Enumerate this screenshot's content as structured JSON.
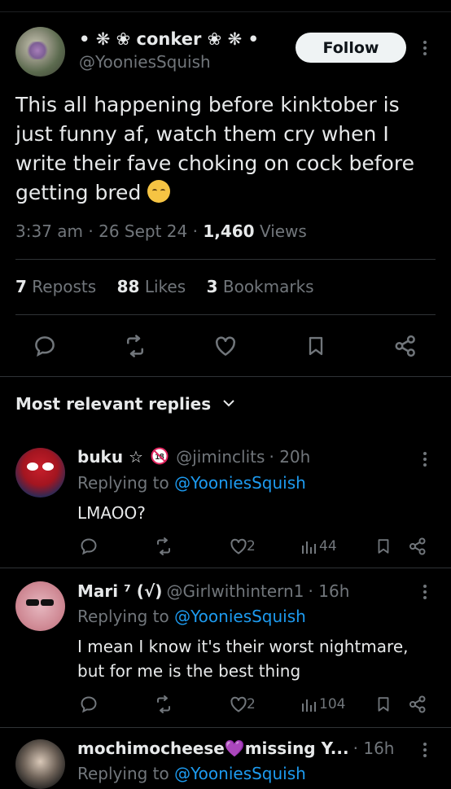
{
  "tweet": {
    "display_name": "• ❋ ❀ conker ❀ ❋ •",
    "handle": "@YooniesSquish",
    "follow_label": "Follow",
    "text": "This all happening before kinktober is just funny af, watch them cry when I write their fave choking on cock before getting bred",
    "time": "3:37 am",
    "date": "26 Sept 24",
    "views_count": "1,460",
    "views_label": "Views",
    "reposts_count": "7",
    "reposts_label": "Reposts",
    "likes_count": "88",
    "likes_label": "Likes",
    "bookmarks_count": "3",
    "bookmarks_label": "Bookmarks"
  },
  "replies_header": "Most relevant replies",
  "replies": [
    {
      "name": "buku ☆",
      "handle": "@jiminclits",
      "age": "20h",
      "replying_prefix": "Replying to",
      "replying_to": "@YooniesSquish",
      "text": "LMAOO?",
      "likes": "2",
      "views": "44"
    },
    {
      "name": "Mari ⁷ (√)",
      "handle": "@Girlwithintern1",
      "age": "16h",
      "replying_prefix": "Replying to",
      "replying_to": "@YooniesSquish",
      "text": "I mean I know it's their worst nightmare, but for me is the best thing",
      "likes": "2",
      "views": "104"
    },
    {
      "name": "mochimocheese💜missing Y...",
      "age": "16h",
      "replying_prefix": "Replying to",
      "replying_to": "@YooniesSquish"
    }
  ],
  "colors": {
    "background": "#000000",
    "text": "#e7e9ea",
    "muted": "#71767b",
    "link": "#1d9bf0"
  }
}
